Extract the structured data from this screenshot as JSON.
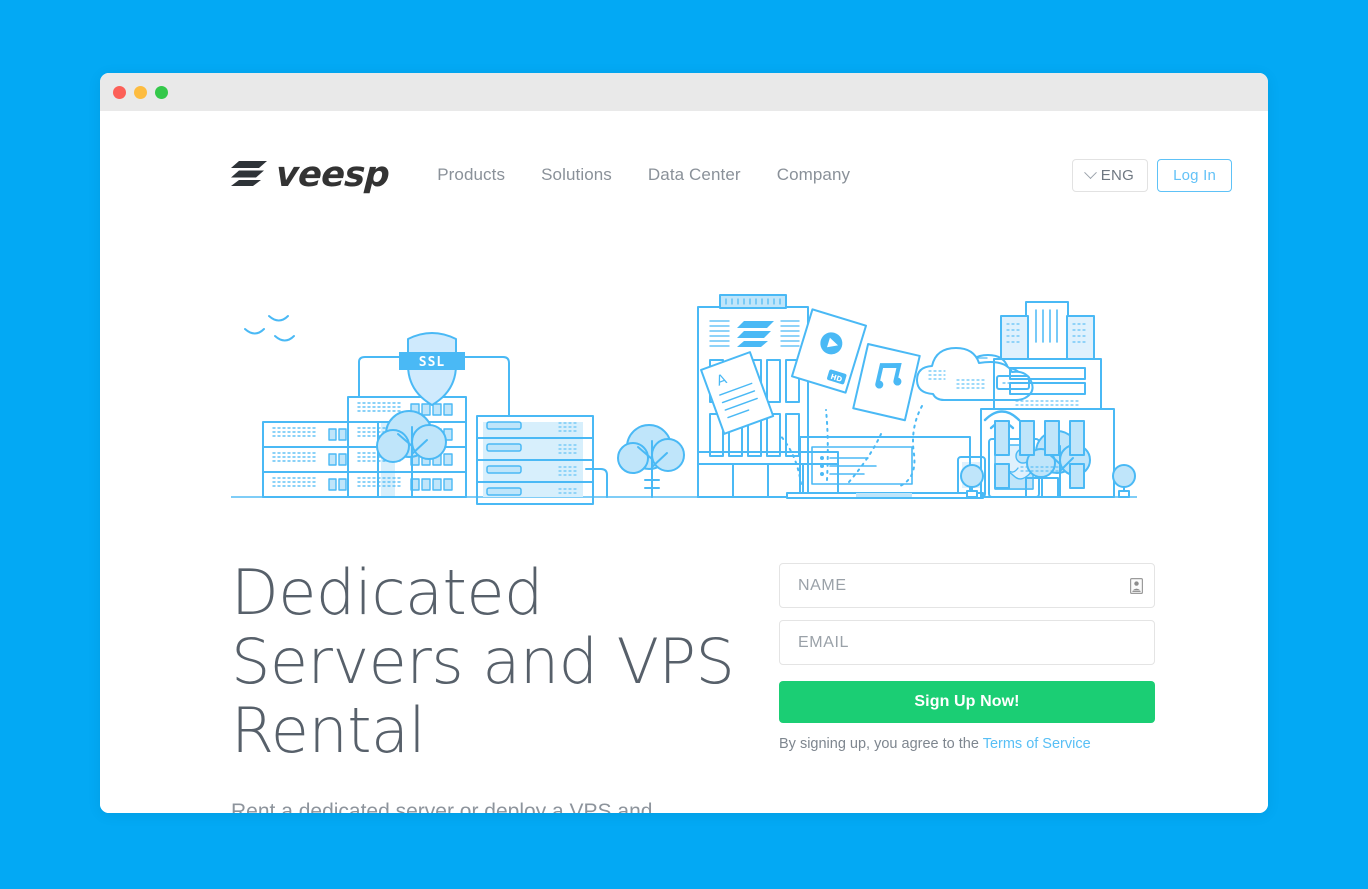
{
  "window": {
    "traffic_lights": [
      "close",
      "minimize",
      "maximize"
    ]
  },
  "header": {
    "logo_text": "veesp",
    "logo_icon": "veesp-stack-logo-icon",
    "nav": [
      {
        "label": "Products"
      },
      {
        "label": "Solutions"
      },
      {
        "label": "Data Center"
      },
      {
        "label": "Company"
      }
    ],
    "language": {
      "label": "ENG",
      "icon": "chevron-down-icon"
    },
    "login_label": "Log In"
  },
  "illustration": {
    "name": "data-center-city-illustration",
    "ssl_badge_label": "SSL",
    "accent_color": "#44b8f5",
    "fill_color": "#bfe5fa"
  },
  "hero": {
    "title": "Dedicated\nServers and VPS\nRental",
    "subtitle": "Rent a dedicated server or deploy a VPS and get a\nwide range of additional services depend on the"
  },
  "signup": {
    "name_placeholder": "NAME",
    "name_value": "",
    "name_icon": "contact-card-autofill-icon",
    "email_placeholder": "EMAIL",
    "email_value": "",
    "submit_label": "Sign Up Now!",
    "terms_prefix": "By signing up, you agree to the ",
    "terms_link_label": "Terms of Service"
  },
  "colors": {
    "page_background": "#03a9f4",
    "titlebar": "#e9e9e9",
    "accent_green": "#1bce74",
    "accent_blue": "#58bff5",
    "nav_text": "#8a9199",
    "heading_text": "#57606a"
  }
}
